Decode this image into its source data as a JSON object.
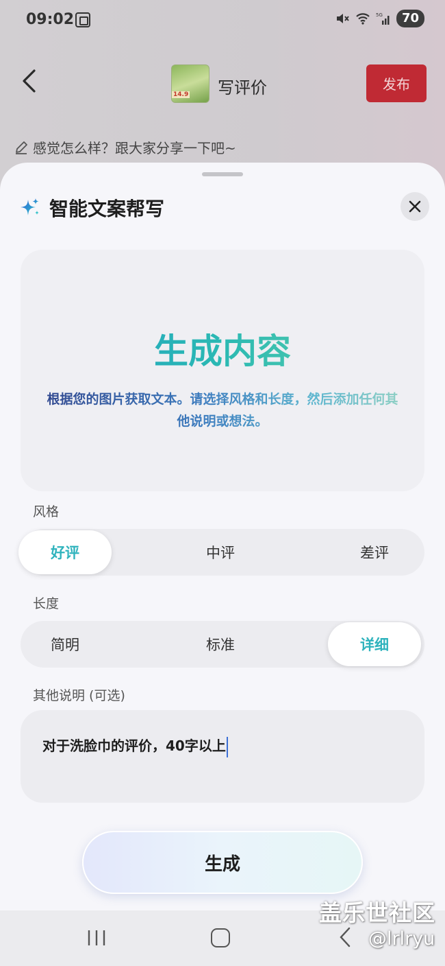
{
  "status_bar": {
    "time": "09:02",
    "battery": "70",
    "network": "5G",
    "icons": [
      "screenshot-icon",
      "mute-icon",
      "wifi-icon",
      "signal-icon"
    ]
  },
  "header": {
    "title": "写评价",
    "publish_label": "发布",
    "product_price_tag": "14.9"
  },
  "review_hint": "感觉怎么样？跟大家分享一下吧~",
  "sheet": {
    "title": "智能文案帮写",
    "card": {
      "title": "生成内容",
      "description": "根据您的图片获取文本。请选择风格和长度，然后添加任何其他说明或想法。"
    },
    "style": {
      "label": "风格",
      "options": [
        "好评",
        "中评",
        "差评"
      ],
      "selected": "好评"
    },
    "length": {
      "label": "长度",
      "options": [
        "简明",
        "标准",
        "详细"
      ],
      "selected": "详细"
    },
    "notes": {
      "label": "其他说明 (可选)",
      "value": "对于洗脸巾的评价，40字以上"
    },
    "generate_label": "生成"
  },
  "watermark": {
    "site": "盖乐世社区",
    "user": "@lrlryu"
  },
  "colors": {
    "accent_teal": "#2fb3bd",
    "publish_red": "#c02a34",
    "sheet_bg": "#f6f6fa"
  }
}
